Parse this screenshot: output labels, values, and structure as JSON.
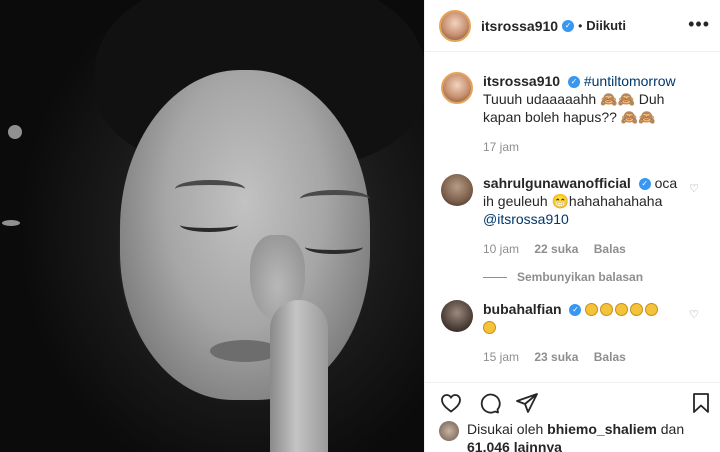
{
  "post": {
    "username": "itsrossa910",
    "separator": "•",
    "follow_status": "Diikuti",
    "more_menu": "•••"
  },
  "caption": {
    "username": "itsrossa910",
    "hashtag": "#untiltomorrow",
    "text": "Tuuuh udaaaaahh 🙈🙈 Duh kapan boleh hapus?? 🙈🙈",
    "time": "17 jam"
  },
  "comments": [
    {
      "username": "sahrulgunawanofficial",
      "text": "oca ih geuleuh 😁hahahahahaha",
      "mention": "@itsrossa910",
      "time": "10 jam",
      "likes": "22 suka",
      "reply": "Balas"
    },
    {
      "username": "bubahalfian",
      "text": "",
      "time": "15 jam",
      "likes": "23 suka",
      "reply": "Balas"
    }
  ],
  "hide_replies": "Sembunyikan balasan",
  "footer": {
    "liked_by_prefix": "Disukai oleh",
    "liked_by_user": "bhiemo_shaliem",
    "and": "dan",
    "count": "61,046",
    "others": "lainnya"
  },
  "icons": [
    "verified-badge-icon",
    "heart-icon",
    "comment-icon",
    "share-icon",
    "bookmark-icon",
    "more-icon"
  ],
  "colors": {
    "verified": "#3897f0",
    "link": "#00376b",
    "muted": "#8e8e8e",
    "text": "#262626"
  }
}
